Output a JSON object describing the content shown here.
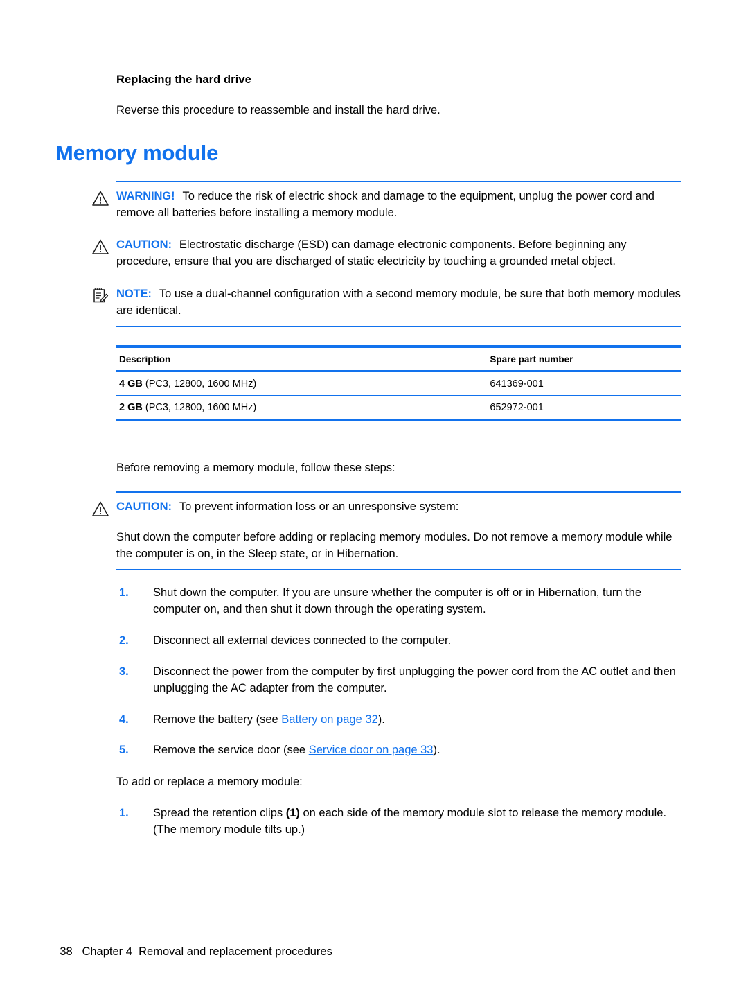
{
  "document": {
    "sub_heading": "Replacing the hard drive",
    "sub_heading_body": "Reverse this procedure to reassemble and install the hard drive.",
    "section_title": "Memory module"
  },
  "admonitions": {
    "warning": {
      "icon": "warning-triangle-icon",
      "label": "WARNING!",
      "text": "To reduce the risk of electric shock and damage to the equipment, unplug the power cord and remove all batteries before installing a memory module."
    },
    "caution_esd": {
      "icon": "warning-triangle-icon",
      "label": "CAUTION:",
      "text": "Electrostatic discharge (ESD) can damage electronic components. Before beginning any procedure, ensure that you are discharged of static electricity by touching a grounded metal object."
    },
    "note": {
      "icon": "note-pad-icon",
      "label": "NOTE:",
      "text": "To use a dual-channel configuration with a second memory module, be sure that both memory modules are identical."
    },
    "caution_info_loss": {
      "icon": "warning-triangle-icon",
      "label": "CAUTION:",
      "text": "To prevent information loss or an unresponsive system:",
      "extra": "Shut down the computer before adding or replacing memory modules. Do not remove a memory module while the computer is on, in the Sleep state, or in Hibernation."
    }
  },
  "spec_table": {
    "headers": [
      "Description",
      "Spare part number"
    ],
    "rows": [
      {
        "desc_bold": "4 GB",
        "desc_rest": "(PC3, 12800, 1600 MHz)",
        "part": "641369-001"
      },
      {
        "desc_bold": "2 GB",
        "desc_rest": "(PC3, 12800, 1600 MHz)",
        "part": "652972-001"
      }
    ]
  },
  "before_removing": {
    "lead": "Before removing a memory module, follow these steps:",
    "steps": [
      {
        "num": "1.",
        "text": "Shut down the computer. If you are unsure whether the computer is off or in Hibernation, turn the computer on, and then shut it down through the operating system."
      },
      {
        "num": "2.",
        "text": "Disconnect all external devices connected to the computer."
      },
      {
        "num": "3.",
        "text": "Disconnect the power from the computer by first unplugging the power cord from the AC outlet and then unplugging the AC adapter from the computer."
      },
      {
        "num": "4.",
        "pre": "Remove the battery (see ",
        "link": "Battery on page 32",
        "post": ")."
      },
      {
        "num": "5.",
        "pre": "Remove the service door (see ",
        "link": "Service door on page 33",
        "post": ")."
      }
    ]
  },
  "add_replace": {
    "lead": "To add or replace a memory module:",
    "steps": [
      {
        "num": "1.",
        "pre": "Spread the retention clips ",
        "bold": "(1)",
        "post": " on each side of the memory module slot to release the memory module. (The memory module tilts up.)"
      }
    ]
  },
  "footer": {
    "page_number": "38",
    "chapter": "Chapter 4",
    "chapter_title": "Removal and replacement procedures"
  },
  "colors": {
    "accent_blue": "#1272ed",
    "text_black": "#000000"
  }
}
